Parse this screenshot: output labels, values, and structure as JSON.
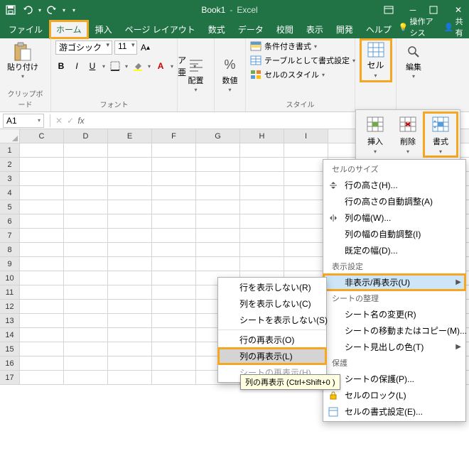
{
  "titlebar": {
    "doc_name": "Book1",
    "app_name": "Excel"
  },
  "tabs": {
    "file": "ファイル",
    "home": "ホーム",
    "insert": "挿入",
    "page_layout": "ページ レイアウト",
    "formulas": "数式",
    "data": "データ",
    "review": "校閲",
    "view": "表示",
    "developer": "開発",
    "help": "ヘルプ",
    "tell_me": "操作アシス",
    "share": "共有"
  },
  "ribbon": {
    "clipboard": {
      "paste": "貼り付け",
      "label": "クリップボード"
    },
    "font": {
      "name": "游ゴシック",
      "size": "11",
      "label": "フォント"
    },
    "align": {
      "label": "配置"
    },
    "styles": {
      "cond_format": "条件付き書式",
      "as_table": "テーブルとして書式設定",
      "cell_styles": "セルのスタイル",
      "label": "スタイル"
    },
    "cells": {
      "cell": "セル",
      "label": ""
    },
    "editing": {
      "label": "編集"
    }
  },
  "cells_panel": {
    "insert": "挿入",
    "delete": "削除",
    "format": "書式"
  },
  "formula_bar": {
    "name": "A1"
  },
  "grid": {
    "cols": [
      "C",
      "D",
      "E",
      "F",
      "G",
      "H",
      "I"
    ],
    "rows": [
      "1",
      "2",
      "3",
      "4",
      "5",
      "6",
      "7",
      "8",
      "9",
      "10",
      "11",
      "12",
      "13",
      "14",
      "15",
      "16",
      "17"
    ]
  },
  "format_menu": {
    "section_size": "セルのサイズ",
    "row_height": "行の高さ(H)...",
    "autofit_row": "行の高さの自動調整(A)",
    "col_width": "列の幅(W)...",
    "autofit_col": "列の幅の自動調整(I)",
    "default_width": "既定の幅(D)...",
    "section_visibility": "表示設定",
    "hide_unhide": "非表示/再表示(U)",
    "section_organize": "シートの整理",
    "rename": "シート名の変更(R)",
    "move_copy": "シートの移動またはコピー(M)...",
    "tab_color": "シート見出しの色(T)",
    "section_protect": "保護",
    "protect_sheet": "シートの保護(P)...",
    "lock_cell": "セルのロック(L)",
    "format_cells": "セルの書式設定(E)..."
  },
  "submenu": {
    "hide_rows": "行を表示しない(R)",
    "hide_cols": "列を表示しない(C)",
    "hide_sheet": "シートを表示しない(S)",
    "unhide_rows": "行の再表示(O)",
    "unhide_cols": "列の再表示(L)",
    "unhide_sheet": "シートの再表示(H)..."
  },
  "tooltip": "列の再表示 (Ctrl+Shift+0 )"
}
